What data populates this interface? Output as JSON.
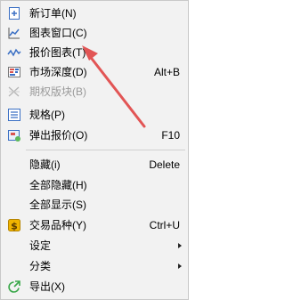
{
  "menu": {
    "items": [
      {
        "label": "新订单(N)",
        "shortcut": "",
        "icon": "new-order-icon"
      },
      {
        "label": "图表窗口(C)",
        "shortcut": "",
        "icon": "chart-window-icon"
      },
      {
        "label": "报价图表(T)",
        "shortcut": "",
        "icon": "quote-chart-icon"
      },
      {
        "label": "市场深度(D)",
        "shortcut": "Alt+B",
        "icon": "market-depth-icon"
      },
      {
        "label": "期权版块(B)",
        "shortcut": "",
        "icon": "options-board-icon",
        "disabled": true
      },
      {
        "label": "规格(P)",
        "shortcut": "",
        "icon": "specification-icon"
      },
      {
        "label": "弹出报价(O)",
        "shortcut": "F10",
        "icon": "popup-quotes-icon"
      },
      {
        "label": "隐藏(i)",
        "shortcut": "Delete",
        "icon": ""
      },
      {
        "label": "全部隐藏(H)",
        "shortcut": "",
        "icon": ""
      },
      {
        "label": "全部显示(S)",
        "shortcut": "",
        "icon": ""
      },
      {
        "label": "交易品种(Y)",
        "shortcut": "Ctrl+U",
        "icon": "symbols-icon"
      },
      {
        "label": "设定",
        "shortcut": "",
        "icon": "",
        "submenu": true
      },
      {
        "label": "分类",
        "shortcut": "",
        "icon": "",
        "submenu": true
      },
      {
        "label": "导出(X)",
        "shortcut": "",
        "icon": "export-icon"
      }
    ]
  },
  "colors": {
    "menu_background": "#f2f2f2",
    "annotation_arrow": "#e25555",
    "disabled_text": "#9a9a9a"
  }
}
